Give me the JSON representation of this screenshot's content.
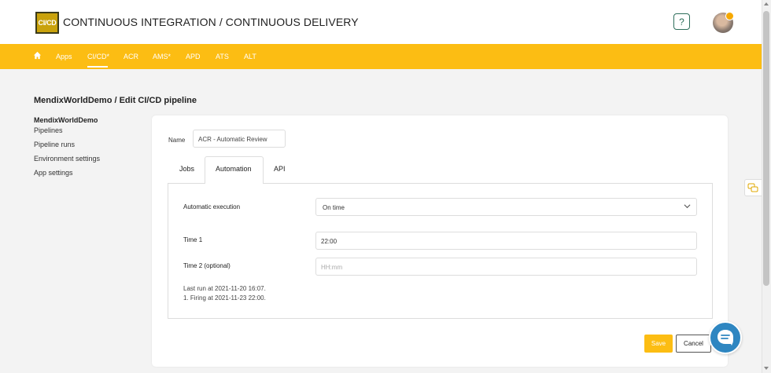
{
  "header": {
    "logo_text": "CI/CD",
    "title": "CONTINUOUS INTEGRATION / CONTINUOUS DELIVERY",
    "help_label": "?"
  },
  "nav": {
    "items": [
      "Apps",
      "CI/CD*",
      "ACR",
      "AMS*",
      "APD",
      "ATS",
      "ALT"
    ],
    "active": "CI/CD*"
  },
  "page_title": "MendixWorldDemo / Edit CI/CD pipeline",
  "sidebar": {
    "title": "MendixWorldDemo",
    "items": [
      "Pipelines",
      "Pipeline runs",
      "Environment settings",
      "App settings"
    ]
  },
  "form": {
    "name_label": "Name",
    "name_value": "ACR - Automatic Review",
    "tabs": [
      "Jobs",
      "Automation",
      "API"
    ],
    "active_tab": "Automation",
    "automatic_execution_label": "Automatic execution",
    "automatic_execution_value": "On time",
    "time1_label": "Time 1",
    "time1_value": "22:00",
    "time2_label": "Time 2 (optional)",
    "time2_placeholder": "HH:mm",
    "last_run": "Last run at 2021-11-20 16:07.",
    "firing": "1. Firing at 2021-11-23 22:00."
  },
  "buttons": {
    "save": "Save",
    "cancel": "Cancel"
  },
  "colors": {
    "accent": "#fcbd13",
    "chat": "#2e86c1",
    "help_border": "#2f6f5c"
  }
}
